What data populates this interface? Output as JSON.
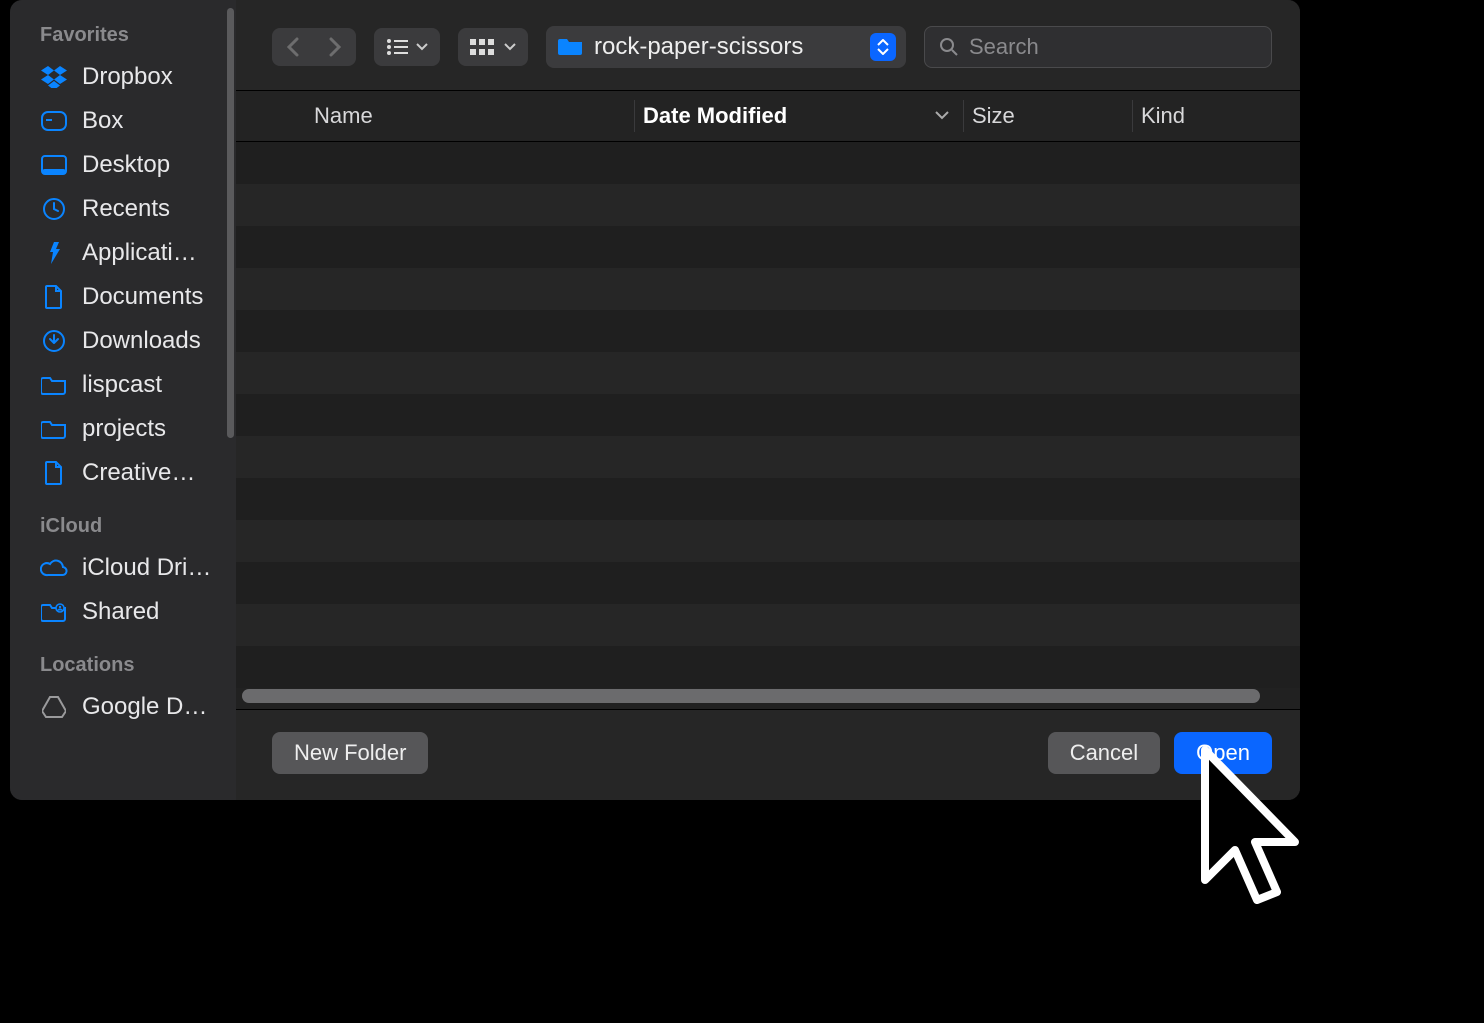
{
  "sidebar": {
    "sections": [
      {
        "header": "Favorites",
        "items": [
          {
            "icon": "dropbox",
            "label": "Dropbox"
          },
          {
            "icon": "disk",
            "label": "Box"
          },
          {
            "icon": "desktop",
            "label": "Desktop"
          },
          {
            "icon": "clock",
            "label": "Recents"
          },
          {
            "icon": "apps",
            "label": "Applicati…"
          },
          {
            "icon": "document",
            "label": "Documents"
          },
          {
            "icon": "download",
            "label": "Downloads"
          },
          {
            "icon": "folder",
            "label": "lispcast"
          },
          {
            "icon": "folder",
            "label": "projects"
          },
          {
            "icon": "document",
            "label": "Creative…"
          }
        ]
      },
      {
        "header": "iCloud",
        "items": [
          {
            "icon": "cloud",
            "label": "iCloud Dri…"
          },
          {
            "icon": "shared",
            "label": "Shared"
          }
        ]
      },
      {
        "header": "Locations",
        "items": [
          {
            "icon": "gdrive",
            "label": "Google D…"
          }
        ]
      }
    ]
  },
  "toolbar": {
    "current_folder": "rock-paper-scissors",
    "search_placeholder": "Search"
  },
  "columns": {
    "name": "Name",
    "date": "Date Modified",
    "size": "Size",
    "kind": "Kind"
  },
  "footer": {
    "new_folder": "New Folder",
    "cancel": "Cancel",
    "open": "Open"
  }
}
